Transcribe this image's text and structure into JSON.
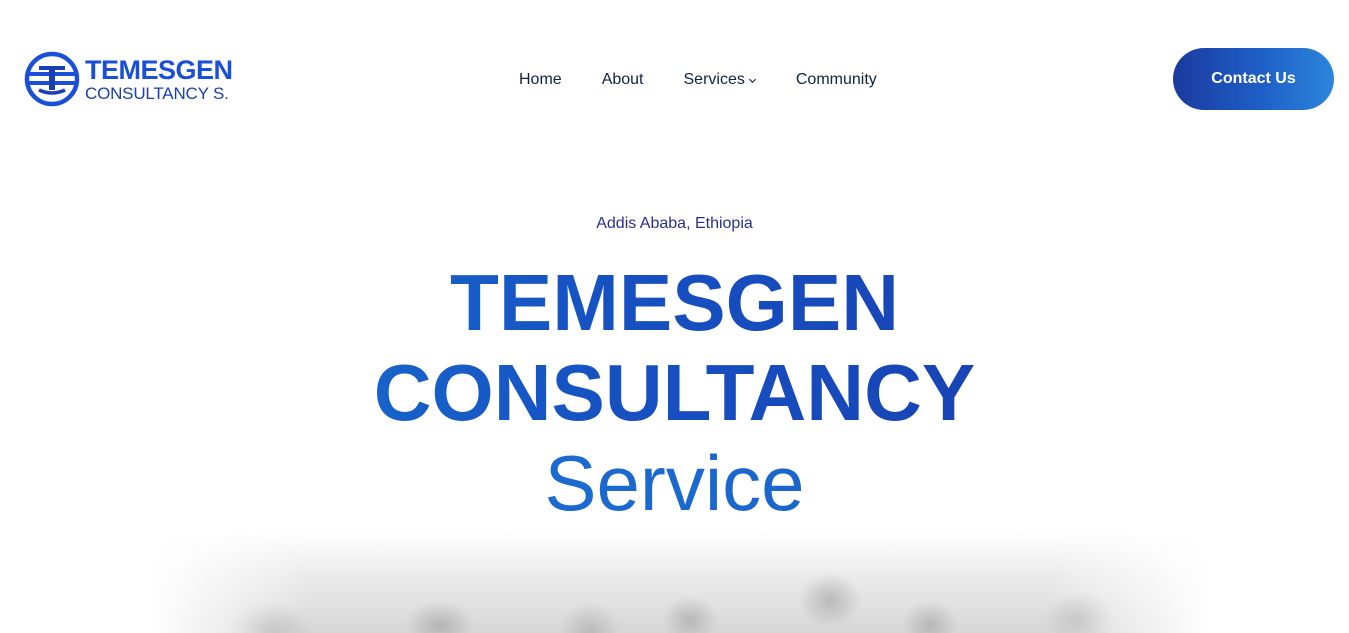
{
  "header": {
    "logo": {
      "line1": "TEMESGEN",
      "line2": "CONSULTANCY S.",
      "icon": "temesgen-logo-icon"
    },
    "nav": {
      "home": "Home",
      "about": "About",
      "services": "Services",
      "services_icon": "chevron-down-icon",
      "community": "Community"
    },
    "contact_label": "Contact Us"
  },
  "hero": {
    "location": "Addis Ababa, Ethiopia",
    "title_line1": "TEMESGEN",
    "title_line2": "CONSULTANCY",
    "title_line3": "Service"
  },
  "colors": {
    "brand_blue": "#1a4fd8",
    "nav_text": "#10233f",
    "button_start": "#1b3a9e",
    "button_end": "#2c86db",
    "location_text": "#2a2f8f"
  }
}
